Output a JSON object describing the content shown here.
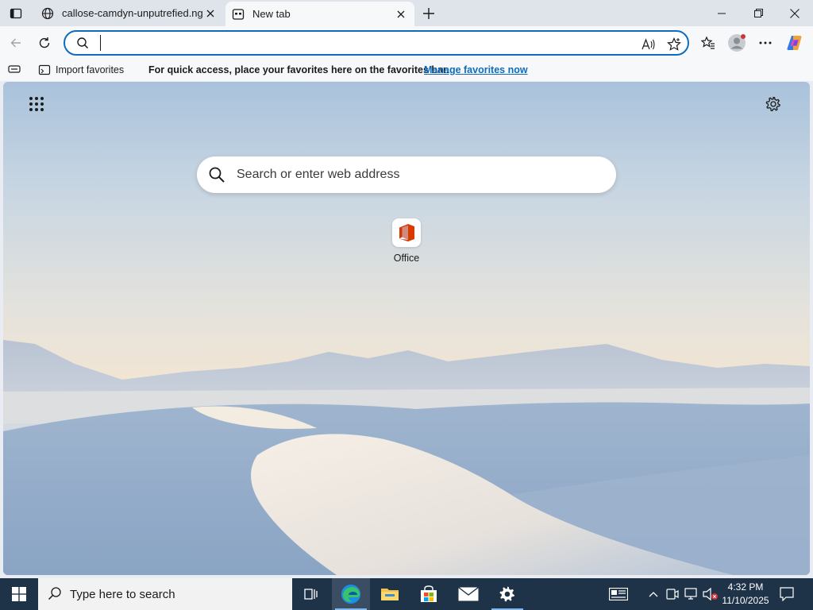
{
  "browser": {
    "tabs": [
      {
        "title": "callose-camdyn-unputrefied.ngrok",
        "favicon": "globe-icon",
        "active": false
      },
      {
        "title": "New tab",
        "favicon": "new-tab-page-icon",
        "active": true
      }
    ],
    "window_controls": [
      "minimize-icon",
      "restore-icon",
      "close-icon"
    ]
  },
  "toolbar": {
    "address_value": "",
    "address_placeholder": "",
    "icons": [
      "back-icon",
      "refresh-icon",
      "search-icon",
      "read-aloud-icon",
      "favorite-star-icon",
      "favorites-collection-icon",
      "profile-avatar-icon",
      "more-menu-icon",
      "copilot-icon"
    ]
  },
  "favorites_bar": {
    "import_label": "Import favorites",
    "message": "For quick access, place your favorites here on the favorites bar.",
    "link": "Manage favorites now"
  },
  "new_tab_page": {
    "search_placeholder": "Search or enter web address",
    "quick_links": [
      {
        "label": "Office",
        "icon": "office-icon"
      }
    ]
  },
  "taskbar": {
    "search_placeholder": "Type here to search",
    "apps": [
      "task-view-icon",
      "edge-icon",
      "file-explorer-icon",
      "store-icon",
      "mail-icon",
      "settings-icon"
    ],
    "clock": {
      "time": "4:32 PM",
      "date": "11/10/2025"
    }
  },
  "colors": {
    "accent": "#0f6cbd",
    "taskbar": "#1f3348"
  }
}
